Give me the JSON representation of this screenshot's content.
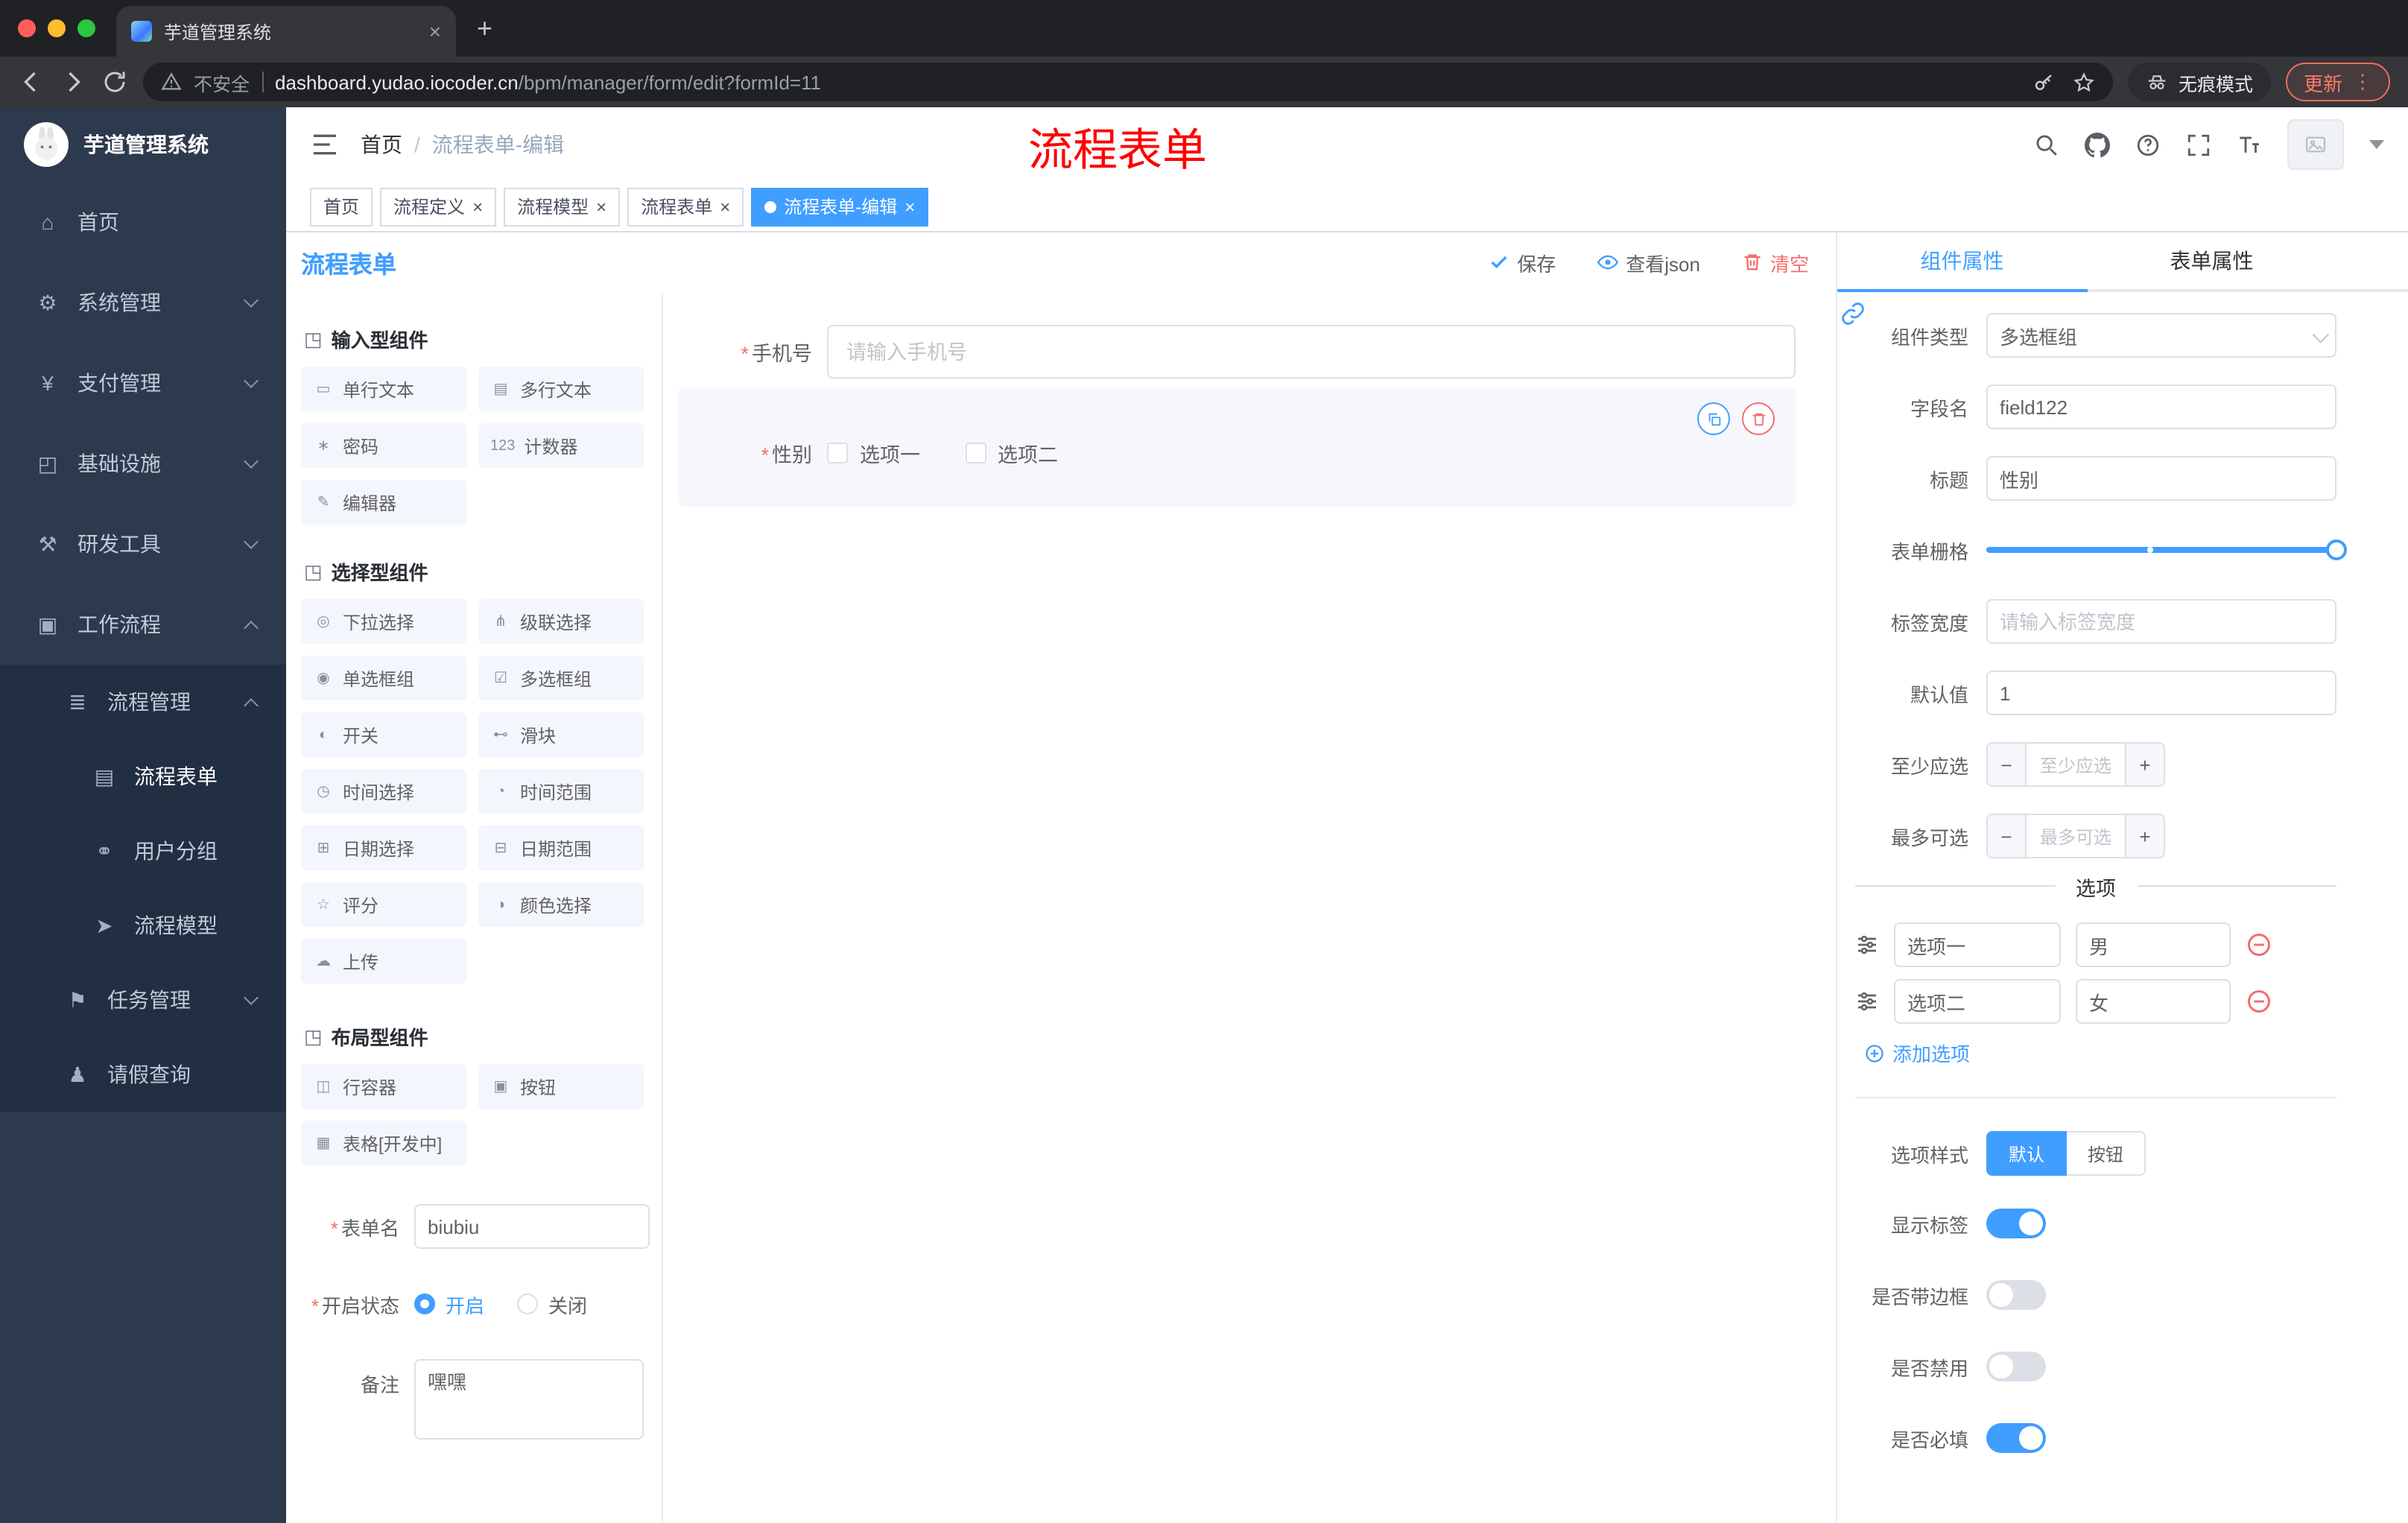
{
  "browser": {
    "tab_title": "芋道管理系统",
    "security_label": "不安全",
    "url_domain": "dashboard.yudao.iocoder.cn",
    "url_path": "/bpm/manager/form/edit?formId=11",
    "incognito_label": "无痕模式",
    "update_label": "更新"
  },
  "icons": {
    "new_tab": "+",
    "close": "×",
    "more_vert": "⋮",
    "stepper_minus": "−",
    "stepper_plus": "+"
  },
  "annotation": {
    "text": "流程表单"
  },
  "sidebar": {
    "logo_title": "芋道管理系统",
    "menu": [
      {
        "label": "首页",
        "icon": "⌂"
      },
      {
        "label": "系统管理",
        "icon": "⚙"
      },
      {
        "label": "支付管理",
        "icon": "¥"
      },
      {
        "label": "基础设施",
        "icon": "◰"
      },
      {
        "label": "研发工具",
        "icon": "⚒"
      },
      {
        "label": "工作流程",
        "icon": "▣"
      },
      {
        "label": "流程管理",
        "icon": "≣"
      },
      {
        "label": "流程表单",
        "icon": "▤"
      },
      {
        "label": "用户分组",
        "icon": "⚭"
      },
      {
        "label": "流程模型",
        "icon": "➤"
      },
      {
        "label": "任务管理",
        "icon": "⚑"
      },
      {
        "label": "请假查询",
        "icon": "♟"
      }
    ]
  },
  "header": {
    "breadcrumb_home": "首页",
    "breadcrumb_sep": "/",
    "breadcrumb_current": "流程表单-编辑"
  },
  "tags": [
    {
      "label": "首页"
    },
    {
      "label": "流程定义"
    },
    {
      "label": "流程模型"
    },
    {
      "label": "流程表单"
    },
    {
      "label": "流程表单-编辑"
    }
  ],
  "designer": {
    "title": "流程表单",
    "save_label": "保存",
    "view_json_label": "查看json",
    "clear_label": "清空",
    "groups": [
      {
        "title": "输入型组件",
        "icon": "◳",
        "items": [
          {
            "label": "单行文本",
            "icon": "▭"
          },
          {
            "label": "多行文本",
            "icon": "▤"
          },
          {
            "label": "密码",
            "icon": "∗"
          },
          {
            "label": "计数器",
            "icon": "123"
          },
          {
            "label": "编辑器",
            "icon": "✎"
          }
        ]
      },
      {
        "title": "选择型组件",
        "icon": "◳",
        "items": [
          {
            "label": "下拉选择",
            "icon": "◎"
          },
          {
            "label": "级联选择",
            "icon": "⋔"
          },
          {
            "label": "单选框组",
            "icon": "◉"
          },
          {
            "label": "多选框组",
            "icon": "☑"
          },
          {
            "label": "开关",
            "icon": "◐"
          },
          {
            "label": "滑块",
            "icon": "⊷"
          },
          {
            "label": "时间选择",
            "icon": "◷"
          },
          {
            "label": "时间范围",
            "icon": "◔"
          },
          {
            "label": "日期选择",
            "icon": "⊞"
          },
          {
            "label": "日期范围",
            "icon": "⊟"
          },
          {
            "label": "评分",
            "icon": "☆"
          },
          {
            "label": "颜色选择",
            "icon": "◑"
          },
          {
            "label": "上传",
            "icon": "☁"
          }
        ]
      },
      {
        "title": "布局型组件",
        "icon": "◳",
        "items": [
          {
            "label": "行容器",
            "icon": "◫"
          },
          {
            "label": "按钮",
            "icon": "▣"
          },
          {
            "label": "表格[开发中]",
            "icon": "▦"
          }
        ]
      }
    ],
    "meta": {
      "form_name_label": "表单名",
      "form_name_value": "biubiu",
      "status_label": "开启状态",
      "status_on": "开启",
      "status_off": "关闭",
      "remark_label": "备注",
      "remark_value": "嘿嘿"
    },
    "canvas": {
      "phone_label": "手机号",
      "phone_placeholder": "请输入手机号",
      "gender_label": "性别",
      "gender_options": [
        "选项一",
        "选项二"
      ]
    }
  },
  "props": {
    "tab_component": "组件属性",
    "tab_form": "表单属性",
    "component_type_label": "组件类型",
    "component_type_value": "多选框组",
    "field_name_label": "字段名",
    "field_name_value": "field122",
    "title_label": "标题",
    "title_value": "性别",
    "grid_label": "表单栅格",
    "label_width_label": "标签宽度",
    "label_width_placeholder": "请输入标签宽度",
    "default_label": "默认值",
    "default_value": "1",
    "min_label": "至少应选",
    "min_placeholder": "至少应选",
    "max_label": "最多可选",
    "max_placeholder": "最多可选",
    "options_divider": "选项",
    "options": [
      {
        "label": "选项一",
        "value": "男"
      },
      {
        "label": "选项二",
        "value": "女"
      }
    ],
    "add_option_label": "添加选项",
    "style_label": "选项样式",
    "style_default": "默认",
    "style_button": "按钮",
    "switch_show_label": "显示标签",
    "switch_border": "是否带边框",
    "switch_disabled": "是否禁用",
    "switch_required": "是否必填"
  },
  "colors": {
    "primary": "#409eff",
    "danger": "#f56c6c"
  }
}
